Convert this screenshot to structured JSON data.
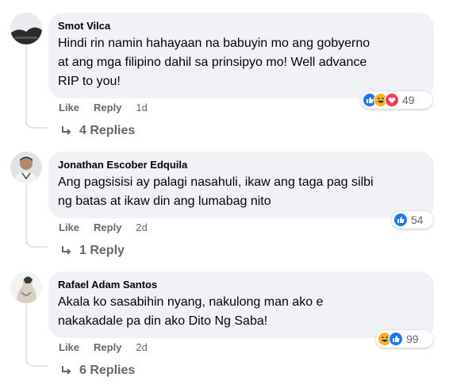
{
  "comments": [
    {
      "author": "Smot Vilca",
      "lines": [
        "Hindi rin namin hahayaan na babuyin mo ang gobyerno",
        "at ang mga filipino dahil sa prinsipyo mo! Well advance",
        "RIP to you!"
      ],
      "like_label": "Like",
      "reply_label": "Reply",
      "time": "1d",
      "reactions": [
        "like-icon",
        "haha-icon",
        "love-icon"
      ],
      "reaction_count": "49",
      "replies_label": "4 Replies"
    },
    {
      "author": "Jonathan Escober Edquila",
      "lines": [
        "Ang pagsisisi ay palagi nasahuli, ikaw ang taga pag silbi",
        "ng batas at ikaw din ang lumabag nito"
      ],
      "like_label": "Like",
      "reply_label": "Reply",
      "time": "2d",
      "reactions": [
        "like-icon"
      ],
      "reaction_count": "54",
      "replies_label": "1 Reply"
    },
    {
      "author": "Rafael Adam Santos",
      "lines": [
        "Akala ko sasabihin nyang, nakulong man ako e",
        "nakakadale pa din ako Dito Ng Saba!"
      ],
      "like_label": "Like",
      "reply_label": "Reply",
      "time": "2d",
      "reactions": [
        "haha-icon",
        "like-icon"
      ],
      "reaction_count": "99",
      "replies_label": "6 Replies"
    }
  ],
  "colors": {
    "bubble": "#f0f2f5",
    "secondary_text": "#65676b",
    "like_blue": "#1877f2",
    "haha_yellow": "#f7b125",
    "love_red": "#f33e58"
  }
}
